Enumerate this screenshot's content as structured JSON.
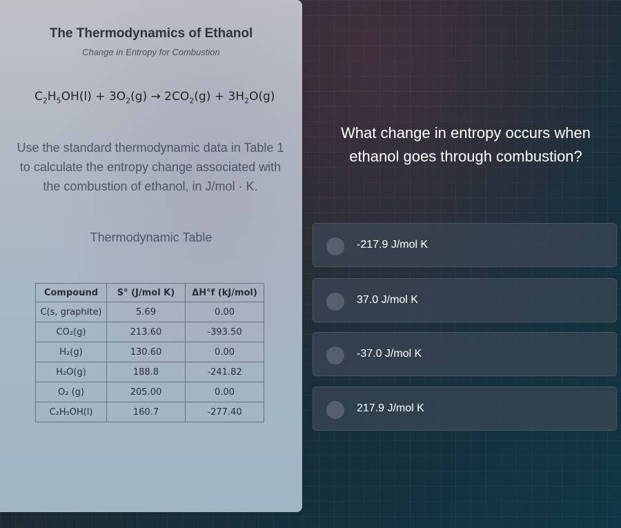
{
  "left": {
    "title": "The Thermodynamics of Ethanol",
    "subtitle": "Change in Entropy for Combustion",
    "equation": [
      {
        "t": "C"
      },
      {
        "sub": "2"
      },
      {
        "t": "H"
      },
      {
        "sub": "5"
      },
      {
        "t": "OH(l) + 3O"
      },
      {
        "sub": "2"
      },
      {
        "t": "(g) → 2CO"
      },
      {
        "sub": "2"
      },
      {
        "t": "(g) + 3H"
      },
      {
        "sub": "2"
      },
      {
        "t": "O(g)"
      }
    ],
    "prompt": "Use the standard thermodynamic data in Table 1 to calculate the entropy change associated with the combustion of ethanol, in J/mol · K.",
    "table_caption": "Thermodynamic Table",
    "table": {
      "headers": [
        "Compound",
        "S° (J/mol K)",
        "ΔH°f (kJ/mol)"
      ],
      "rows": [
        {
          "compound": "C(s, graphite)",
          "s": "5.69",
          "h": "0.00"
        },
        {
          "compound": "CO₂(g)",
          "s": "213.60",
          "h": "-393.50"
        },
        {
          "compound": "H₂(g)",
          "s": "130.60",
          "h": "0.00"
        },
        {
          "compound": "H₂O(g)",
          "s": "188.8",
          "h": "-241.82"
        },
        {
          "compound": "O₂ (g)",
          "s": "205.00",
          "h": "0.00"
        },
        {
          "compound": "C₂H₅OH(l)",
          "s": "160.7",
          "h": "-277.40"
        }
      ]
    }
  },
  "right": {
    "question": "What change in entropy occurs when ethanol goes through combustion?",
    "options": [
      {
        "label": "-217.9 J/mol K"
      },
      {
        "label": "37.0 J/mol K"
      },
      {
        "label": "-37.0 J/mol K"
      },
      {
        "label": "217.9 J/mol K"
      }
    ]
  },
  "colors": {
    "panel_text": "#2e3440",
    "option_bg": "#3c4654",
    "radio": "#56606c"
  }
}
